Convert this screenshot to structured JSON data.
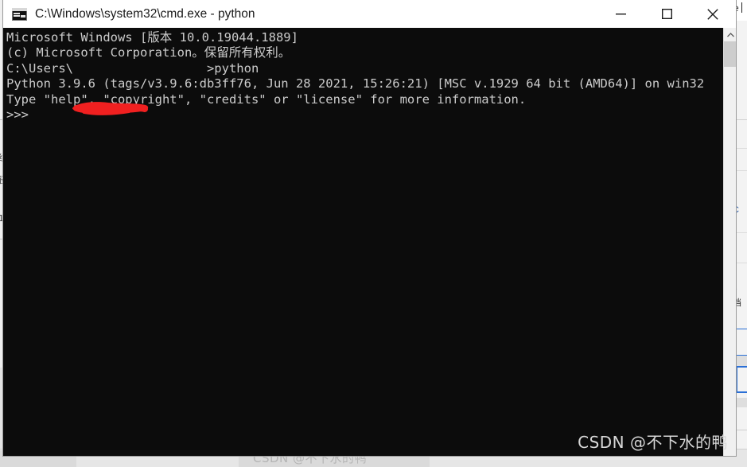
{
  "window": {
    "title": "C:\\Windows\\system32\\cmd.exe - python",
    "icon": "cmd-console-icon",
    "controls": {
      "minimize": "minimize-button",
      "maximize": "maximize-button",
      "close": "close-button"
    }
  },
  "console": {
    "background_color": "#0c0c0c",
    "text_color": "#cccccc",
    "lines": [
      "Microsoft Windows [版本 10.0.19044.1889]",
      "(c) Microsoft Corporation。保留所有权利。",
      "",
      "C:\\Users\\                  >python",
      "Python 3.9.6 (tags/v3.9.6:db3ff76, Jun 28 2021, 15:26:21) [MSC v.1929 64 bit (AMD64)] on win32",
      "Type \"help\", \"copyright\", \"credits\" or \"license\" for more information.",
      ">>>"
    ],
    "redaction": {
      "name": "red-scribble-redaction",
      "color": "#f02020"
    },
    "scrollbar": {
      "arrow": "scroll-up-arrow",
      "position": "top"
    }
  },
  "watermarks": {
    "primary": "CSDN @不下水的鸭",
    "secondary": "CSDN @不下水的鸭"
  },
  "background": {
    "left_app": {
      "glyphs": [
        "组",
        "径",
        "1"
      ]
    },
    "right_app": {
      "header_text": "e",
      "cells": [
        "C",
        "s",
        "档"
      ],
      "accent_color": "#2a6fd6"
    }
  }
}
